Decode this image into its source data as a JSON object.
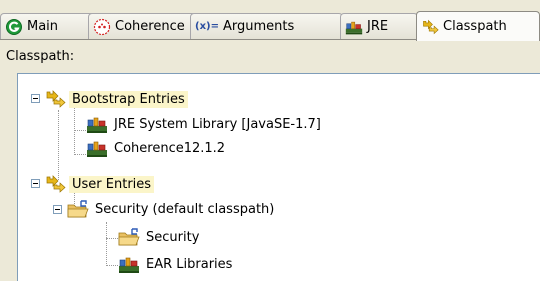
{
  "tabs": [
    {
      "label": "Main",
      "icon": "main-launch-icon",
      "active": false
    },
    {
      "label": "Coherence",
      "icon": "coherence-icon",
      "active": false
    },
    {
      "label": "Arguments",
      "icon": "arguments-icon",
      "icon_text": "(x)=",
      "active": false
    },
    {
      "label": "JRE",
      "icon": "jre-library-icon",
      "active": false
    },
    {
      "label": "Classpath",
      "icon": "classpath-icon",
      "active": true
    }
  ],
  "classpath_label": "Classpath:",
  "tree": {
    "bootstrap": {
      "label": "Bootstrap Entries",
      "children": [
        "JRE System Library [JavaSE-1.7]",
        "Coherence12.1.2"
      ]
    },
    "user": {
      "label": "User Entries",
      "project": {
        "label": "Security (default classpath)",
        "children": [
          "Security",
          "EAR Libraries"
        ]
      }
    }
  },
  "colors": {
    "window_bg": "#ece9d8",
    "highlight": "#fbf5c9",
    "main_icon": "#1f9a3a",
    "coherence_icon": "#d42020"
  }
}
